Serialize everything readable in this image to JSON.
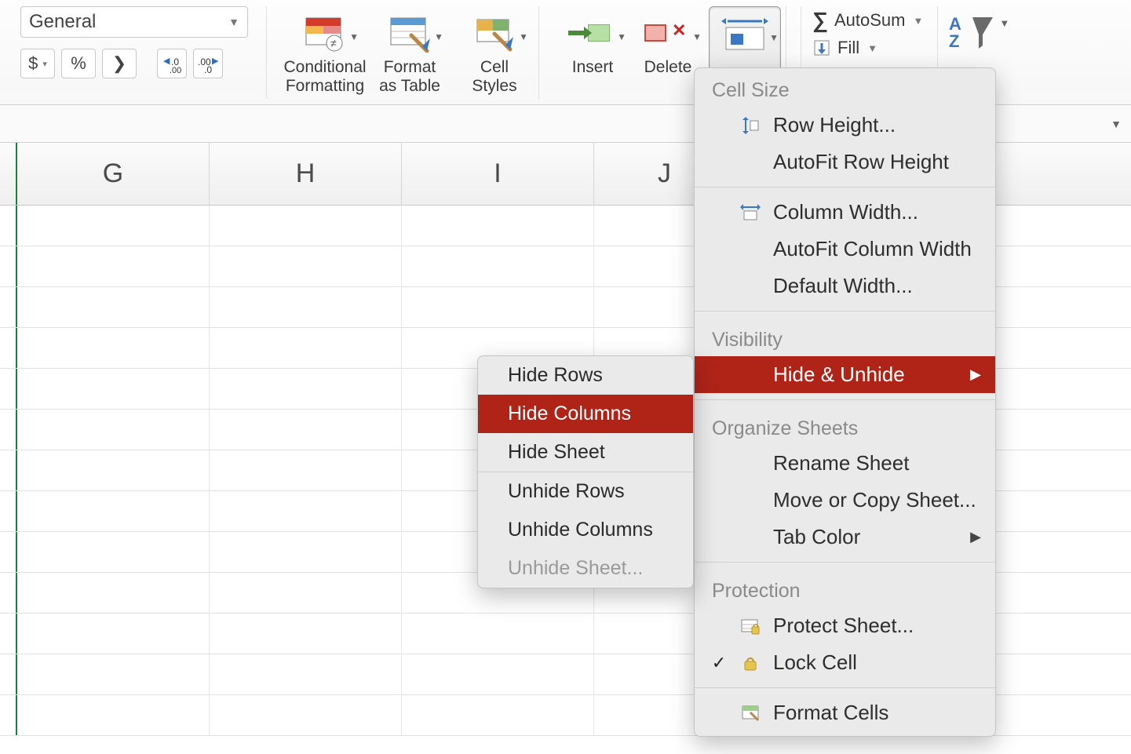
{
  "ribbon": {
    "number_format": {
      "selected": "General"
    },
    "currency_symbol": "$",
    "percent_symbol": "%",
    "comma_symbol": "❯",
    "increase_decimal_label": ".0",
    "decrease_decimal_label": ".00",
    "conditional_formatting": "Conditional\nFormatting",
    "format_as_table": "Format\nas Table",
    "cell_styles": "Cell\nStyles",
    "insert": "Insert",
    "delete": "Delete",
    "autosum": "AutoSum",
    "fill": "Fill"
  },
  "columns": [
    "G",
    "H",
    "I",
    "J"
  ],
  "format_menu": {
    "sections": {
      "cell_size": "Cell Size",
      "visibility": "Visibility",
      "organize": "Organize Sheets",
      "protection": "Protection"
    },
    "row_height": "Row Height...",
    "autofit_row": "AutoFit Row Height",
    "column_width": "Column Width...",
    "autofit_col": "AutoFit Column Width",
    "default_width": "Default Width...",
    "hide_unhide": "Hide & Unhide",
    "rename_sheet": "Rename Sheet",
    "move_copy": "Move or Copy Sheet...",
    "tab_color": "Tab Color",
    "protect_sheet": "Protect Sheet...",
    "lock_cell": "Lock Cell",
    "format_cells": "Format Cells"
  },
  "hide_submenu": {
    "hide_rows": "Hide Rows",
    "hide_columns": "Hide Columns",
    "hide_sheet": "Hide Sheet",
    "unhide_rows": "Unhide Rows",
    "unhide_columns": "Unhide Columns",
    "unhide_sheet": "Unhide Sheet..."
  }
}
